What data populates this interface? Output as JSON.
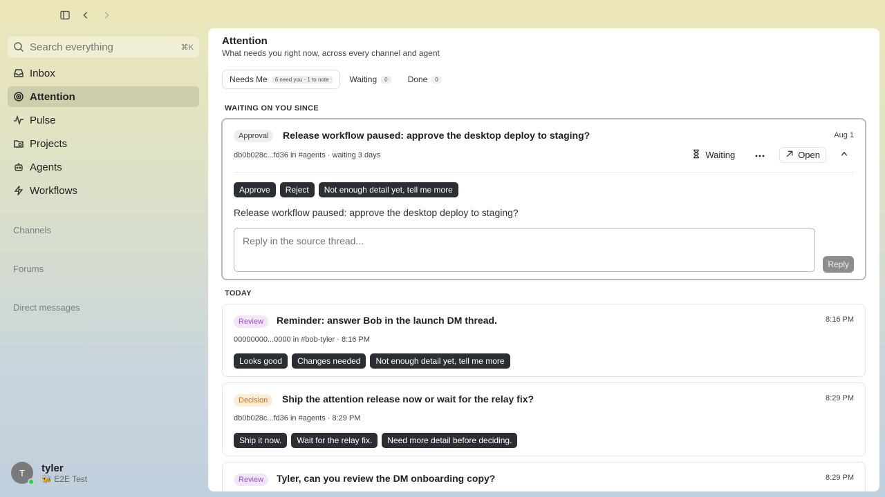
{
  "search": {
    "placeholder": "Search everything",
    "shortcut": "⌘K"
  },
  "nav": [
    {
      "label": "Inbox",
      "icon": "inbox-icon"
    },
    {
      "label": "Attention",
      "icon": "target-icon",
      "active": true
    },
    {
      "label": "Pulse",
      "icon": "pulse-icon"
    },
    {
      "label": "Projects",
      "icon": "folder-icon"
    },
    {
      "label": "Agents",
      "icon": "agent-icon"
    },
    {
      "label": "Workflows",
      "icon": "bolt-icon"
    }
  ],
  "sections": {
    "channels": "Channels",
    "forums": "Forums",
    "dms": "Direct messages"
  },
  "user": {
    "initial": "T",
    "name": "tyler",
    "subtitle": "🐝 E2E Test",
    "status_color": "#2ecc40"
  },
  "page": {
    "title": "Attention",
    "subtitle": "What needs you right now, across every channel and agent"
  },
  "tabs": [
    {
      "label": "Needs Me",
      "count": "6 need you · 1 to note"
    },
    {
      "label": "Waiting",
      "count": "0"
    },
    {
      "label": "Done",
      "count": "0"
    }
  ],
  "groups": {
    "waiting": "WAITING ON YOU SINCE",
    "today": "TODAY"
  },
  "expanded": {
    "badge": "Approval",
    "title": "Release workflow paused: approve the desktop deploy to staging?",
    "time": "Aug 1",
    "meta": "db0b028c...fd36 in #agents · waiting 3 days",
    "actions": {
      "waiting": "Waiting",
      "open": "Open"
    },
    "chips": [
      "Approve",
      "Reject",
      "Not enough detail yet, tell me more"
    ],
    "question": "Release workflow paused: approve the desktop deploy to staging?",
    "reply_placeholder": "Reply in the source thread...",
    "reply_label": "Reply"
  },
  "cards": [
    {
      "badge": "Review",
      "badge_type": "review",
      "title": "Reminder: answer Bob in the launch DM thread.",
      "time": "8:16 PM",
      "meta": "00000000...0000 in #bob-tyler · 8:16 PM",
      "chips": [
        "Looks good",
        "Changes needed",
        "Not enough detail yet, tell me more"
      ]
    },
    {
      "badge": "Decision",
      "badge_type": "decision",
      "title": "Ship the attention release now or wait for the relay fix?",
      "time": "8:29 PM",
      "meta": "db0b028c...fd36 in #agents · 8:29 PM",
      "chips": [
        "Ship it now.",
        "Wait for the relay fix.",
        "Need more detail before deciding."
      ]
    },
    {
      "badge": "Review",
      "badge_type": "review",
      "title": "Tyler, can you review the DM onboarding copy?",
      "time": "8:29 PM"
    }
  ]
}
